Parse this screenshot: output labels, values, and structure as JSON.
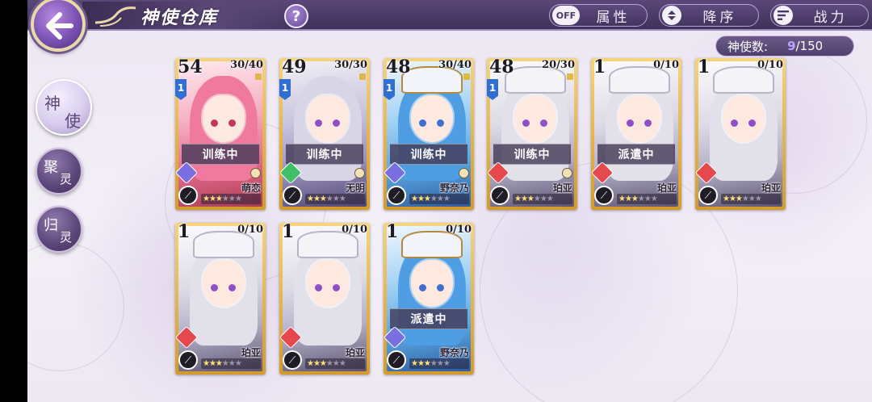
{
  "header": {
    "title": "神使仓库",
    "help_label": "?",
    "attribute_toggle": "OFF",
    "attribute_label": "属性",
    "sort_order_label": "降序",
    "sort_by_label": "战力"
  },
  "counter": {
    "label": "神使数:",
    "current": "9",
    "max": "/150"
  },
  "side_tabs": [
    {
      "label_top": "神",
      "label_bottom": "使",
      "active": true
    },
    {
      "label_top": "聚",
      "label_bottom": "灵",
      "active": false
    },
    {
      "label_top": "归",
      "label_bottom": "灵",
      "active": false
    }
  ],
  "cards": [
    {
      "level": "54",
      "exp": "30/40",
      "rank": "1",
      "status": "训练中",
      "name": "萌恋",
      "element": "purple",
      "art": "pink",
      "stars_filled": 3,
      "stars_total": 6
    },
    {
      "level": "49",
      "exp": "30/30",
      "rank": "1",
      "status": "训练中",
      "name": "无明",
      "element": "green",
      "art": "silver",
      "stars_filled": 3,
      "stars_total": 6
    },
    {
      "level": "48",
      "exp": "30/40",
      "rank": "1",
      "status": "训练中",
      "name": "野奈乃",
      "element": "purple",
      "art": "blue",
      "stars_filled": 3,
      "stars_total": 6
    },
    {
      "level": "48",
      "exp": "20/30",
      "rank": "1",
      "status": "训练中",
      "name": "珀亚",
      "element": "red",
      "art": "white",
      "stars_filled": 3,
      "stars_total": 6
    },
    {
      "level": "1",
      "exp": "0/10",
      "rank": "",
      "status": "派遣中",
      "name": "珀亚",
      "element": "red",
      "art": "white",
      "stars_filled": 3,
      "stars_total": 6
    },
    {
      "level": "1",
      "exp": "0/10",
      "rank": "",
      "status": "",
      "name": "珀亚",
      "element": "red",
      "art": "white",
      "stars_filled": 3,
      "stars_total": 6
    },
    {
      "level": "1",
      "exp": "0/10",
      "rank": "",
      "status": "",
      "name": "珀亚",
      "element": "red",
      "art": "white",
      "stars_filled": 3,
      "stars_total": 6
    },
    {
      "level": "1",
      "exp": "0/10",
      "rank": "",
      "status": "",
      "name": "珀亚",
      "element": "red",
      "art": "white",
      "stars_filled": 3,
      "stars_total": 6
    },
    {
      "level": "1",
      "exp": "0/10",
      "rank": "",
      "status": "派遣中",
      "name": "野奈乃",
      "element": "purple",
      "art": "blue",
      "stars_filled": 3,
      "stars_total": 6
    }
  ],
  "colors": {
    "accent": "#5a4778",
    "card_gold": "#e5b64c",
    "rank_blue": "#2f6fd3"
  }
}
